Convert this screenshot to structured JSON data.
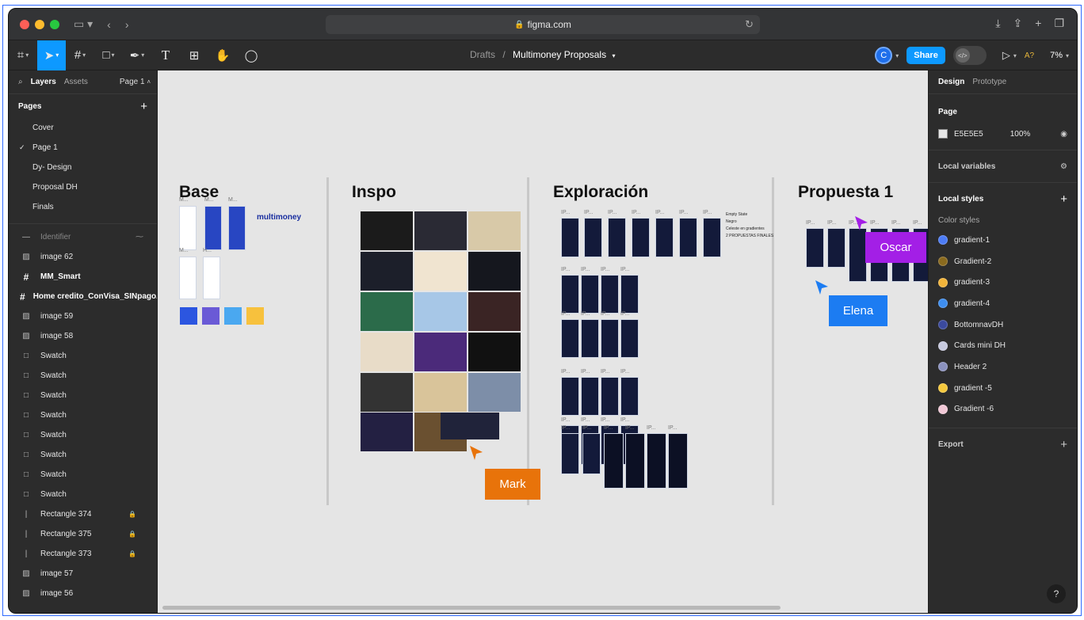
{
  "browser": {
    "url": "figma.com",
    "colors": {
      "red": "#ff5f57",
      "yellow": "#febc2e",
      "green": "#28c840"
    }
  },
  "toolbar": {
    "breadcrumb_parent": "Drafts",
    "breadcrumb_sep": "/",
    "file_name": "Multimoney Proposals",
    "avatar_initial": "C",
    "share_label": "Share",
    "a_badge": "A?",
    "zoom": "7%"
  },
  "left_panel": {
    "tab_layers": "Layers",
    "tab_assets": "Assets",
    "page_selector": "Page 1",
    "pages_title": "Pages",
    "pages": [
      {
        "label": "Cover",
        "current": false
      },
      {
        "label": "Page 1",
        "current": true
      },
      {
        "label": "Dy- Design",
        "current": false
      },
      {
        "label": "Proposal DH",
        "current": false
      },
      {
        "label": "Finals",
        "current": false
      }
    ],
    "layers": [
      {
        "label": "Identifier",
        "icon": "line-icon",
        "style": "dim"
      },
      {
        "label": "image 62",
        "icon": "image-icon",
        "style": "normal"
      },
      {
        "label": "MM_Smart",
        "icon": "frame-icon",
        "style": "bold"
      },
      {
        "label": "Home credito_ConVisa_SINpagoA...",
        "icon": "frame-icon",
        "style": "bold"
      },
      {
        "label": "image 59",
        "icon": "image-icon",
        "style": "normal"
      },
      {
        "label": "image 58",
        "icon": "image-icon",
        "style": "normal"
      },
      {
        "label": "Swatch",
        "icon": "rect-icon",
        "style": "normal"
      },
      {
        "label": "Swatch",
        "icon": "rect-icon",
        "style": "normal"
      },
      {
        "label": "Swatch",
        "icon": "rect-icon",
        "style": "normal"
      },
      {
        "label": "Swatch",
        "icon": "rect-icon",
        "style": "normal"
      },
      {
        "label": "Swatch",
        "icon": "rect-icon",
        "style": "normal"
      },
      {
        "label": "Swatch",
        "icon": "rect-icon",
        "style": "normal"
      },
      {
        "label": "Swatch",
        "icon": "rect-icon",
        "style": "normal"
      },
      {
        "label": "Swatch",
        "icon": "rect-icon",
        "style": "normal"
      },
      {
        "label": "Rectangle 374",
        "icon": "line-icon",
        "style": "normal",
        "locked": true
      },
      {
        "label": "Rectangle 375",
        "icon": "line-icon",
        "style": "normal",
        "locked": true
      },
      {
        "label": "Rectangle 373",
        "icon": "line-icon",
        "style": "normal",
        "locked": true
      },
      {
        "label": "image 57",
        "icon": "image-icon",
        "style": "normal"
      },
      {
        "label": "image 56",
        "icon": "image-icon",
        "style": "normal"
      }
    ]
  },
  "canvas": {
    "background": "#e5e5e5",
    "sections": {
      "base": "Base",
      "inspo": "Inspo",
      "exploracion": "Exploración",
      "propuesta": "Propuesta 1"
    },
    "brand_text": "multimoney",
    "frame_label_short": "M...",
    "frame_label_h": "H...",
    "frame_label_ip": "IP...",
    "base_swatches": [
      "#2c56e0",
      "#6a5ad6",
      "#4aa8f0",
      "#f7c13d"
    ],
    "note_lines": [
      "Empty State",
      "Negro",
      "Celeste en gradientes",
      "2 PROPUESTAS FINALES"
    ],
    "cursors": [
      {
        "name": "Mark",
        "color": "#e8730a"
      },
      {
        "name": "Oscar",
        "color": "#a31fe6"
      },
      {
        "name": "Elena",
        "color": "#1c7cf2"
      }
    ]
  },
  "right_panel": {
    "tab_design": "Design",
    "tab_prototype": "Prototype",
    "page_title": "Page",
    "page_color": "E5E5E5",
    "page_opacity": "100%",
    "local_variables": "Local variables",
    "local_styles": "Local styles",
    "color_styles_label": "Color styles",
    "color_styles": [
      {
        "name": "gradient-1",
        "color": "#4d7cf5"
      },
      {
        "name": "Gradient-2",
        "color": "#8a6a1e"
      },
      {
        "name": "gradient-3",
        "color": "#f2b43a"
      },
      {
        "name": "gradient-4",
        "color": "#3e8ef0"
      },
      {
        "name": "BottomnavDH",
        "color": "#3b4a9e"
      },
      {
        "name": "Cards mini DH",
        "color": "#c6c9de"
      },
      {
        "name": "Header 2",
        "color": "#8b92bf"
      },
      {
        "name": "gradient -5",
        "color": "#f5c93d"
      },
      {
        "name": "Gradient -6",
        "color": "#f1c8d6"
      }
    ],
    "export_title": "Export",
    "help": "?"
  }
}
